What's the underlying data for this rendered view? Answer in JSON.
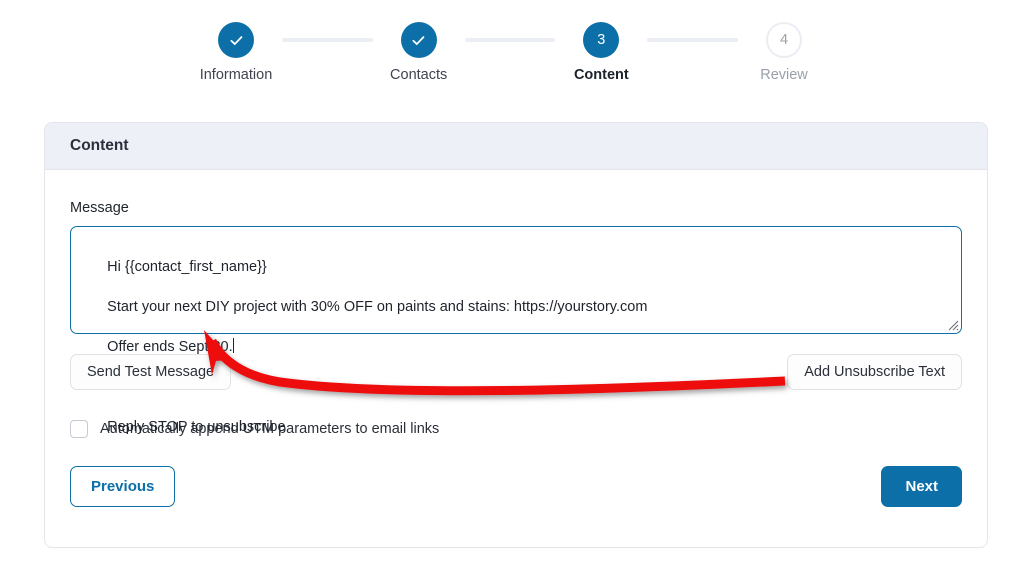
{
  "stepper": {
    "steps": [
      {
        "index": "1",
        "label": "Information",
        "state": "done",
        "icon": "check-icon"
      },
      {
        "index": "2",
        "label": "Contacts",
        "state": "done",
        "icon": "check-icon"
      },
      {
        "index": "3",
        "label": "Content",
        "state": "current",
        "icon": ""
      },
      {
        "index": "4",
        "label": "Review",
        "state": "pending",
        "icon": ""
      }
    ],
    "active_color": "#0c6fa8",
    "pending_color": "#9aa0ab",
    "connector_color": "#eceef5"
  },
  "card": {
    "header_title": "Content",
    "header_bg": "#eef0f8",
    "message": {
      "label": "Message",
      "value": "Hi {{contact_first_name}}\nStart your next DIY project with 30% OFF on paints and stains: https://yourstory.com\nOffer ends Sept 30.\n\nReply STOP to unsubscribe",
      "line1": "Hi {{contact_first_name}}",
      "line2": "Start your next DIY project with 30% OFF on paints and stains: https://yourstory.com",
      "line3": "Offer ends Sept 30.",
      "line4": "",
      "line5": "Reply STOP to unsubscribe",
      "placeholder": "",
      "focused": "true",
      "border_color": "#0c6fa8"
    },
    "actions": {
      "send_test_label": "Send Test Message",
      "add_unsubscribe_label": "Add Unsubscribe Text"
    },
    "utm": {
      "label": "Automatically append UTM parameters to email links",
      "checked": "false"
    },
    "nav": {
      "previous_label": "Previous",
      "next_label": "Next"
    }
  },
  "annotation": {
    "type": "curved-arrow",
    "color": "#ee1111",
    "points_from": "Add Unsubscribe Text",
    "points_to": "Reply STOP to unsubscribe"
  }
}
